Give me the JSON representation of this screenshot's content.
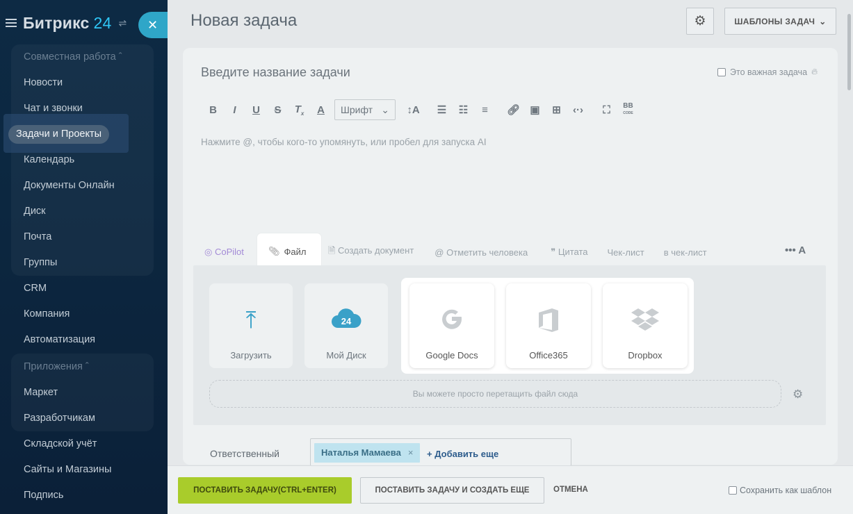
{
  "sidebar": {
    "logo": "Битрикс",
    "logo_num": "24",
    "group_collab": "Совместная работа",
    "items": [
      "Новости",
      "Чат и звонки",
      "Задачи и Проекты",
      "Календарь",
      "Документы Онлайн",
      "Диск",
      "Почта",
      "Группы",
      "CRM",
      "Компания",
      "Автоматизация"
    ],
    "group_apps": "Приложения",
    "apps": [
      "Маркет",
      "Разработчикам",
      "Складской учёт",
      "Сайты и Магазины",
      "Подпись"
    ]
  },
  "header": {
    "title": "Новая задача",
    "templates_label": "ШАБЛОНЫ ЗАДАЧ"
  },
  "task": {
    "title_placeholder": "Введите название задачи",
    "important_label": "Это важная задача",
    "font_label": "Шрифт",
    "editor_placeholder": "Нажмите @, чтобы кого-то упомянуть, или пробел для запуска AI"
  },
  "actions": {
    "copilot": "CoPilot",
    "file": "Файл",
    "create_doc": "Создать документ",
    "mention": "Отметить человека",
    "quote": "Цитата",
    "checklist": "Чек-лист",
    "to_checklist": "в чек-лист"
  },
  "upload": {
    "upload_label": "Загрузить",
    "my_drive_label": "Мой Диск",
    "google_docs": "Google Docs",
    "office365": "Office365",
    "dropbox": "Dropbox",
    "dropzone_text": "Вы можете просто перетащить файл сюда"
  },
  "responsible": {
    "label": "Ответственный",
    "person": "Наталья Мамаева",
    "add_more": "+ Добавить еще"
  },
  "footer": {
    "submit": "ПОСТАВИТЬ ЗАДАЧУ(CTRL+ENTER)",
    "submit_create": "ПОСТАВИТЬ ЗАДАЧУ И СОЗДАТЬ ЕЩЕ",
    "cancel": "ОТМЕНА",
    "save_template": "Сохранить как шаблон"
  },
  "colors": {
    "sidebar_bg": "#0d2a44",
    "accent_blue": "#2fc6f6",
    "primary_green": "#a9cc2b"
  }
}
